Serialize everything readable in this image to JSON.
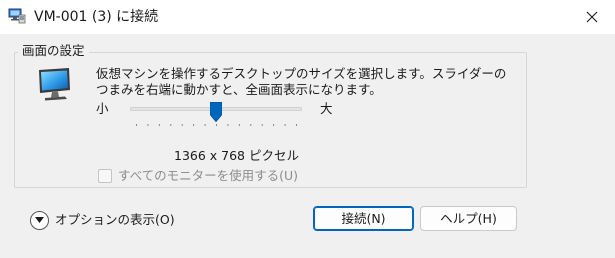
{
  "window": {
    "title": "VM-001 (3) に接続",
    "close_glyph": "✕"
  },
  "display_settings": {
    "group_title": "画面の設定",
    "description_line1": "仮想マシンを操作するデスクトップのサイズを選択します。スライダーの",
    "description_line2": "つまみを右端に動かすと、全画面表示になります。",
    "slider": {
      "min_label": "小",
      "max_label": "大",
      "value_fraction": 0.5,
      "tick_count": 15
    },
    "resolution_text": "1366 x 768 ピクセル",
    "all_monitors_label": "すべてのモニターを使用する(U)",
    "all_monitors_checked": false
  },
  "footer": {
    "options_label": "オプションの表示(O)",
    "connect_label": "接続(N)",
    "help_label": "ヘルプ(H)"
  },
  "colors": {
    "accent": "#0067c0",
    "background": "#f0f0f0",
    "disabled_text": "#8d8d8d"
  }
}
